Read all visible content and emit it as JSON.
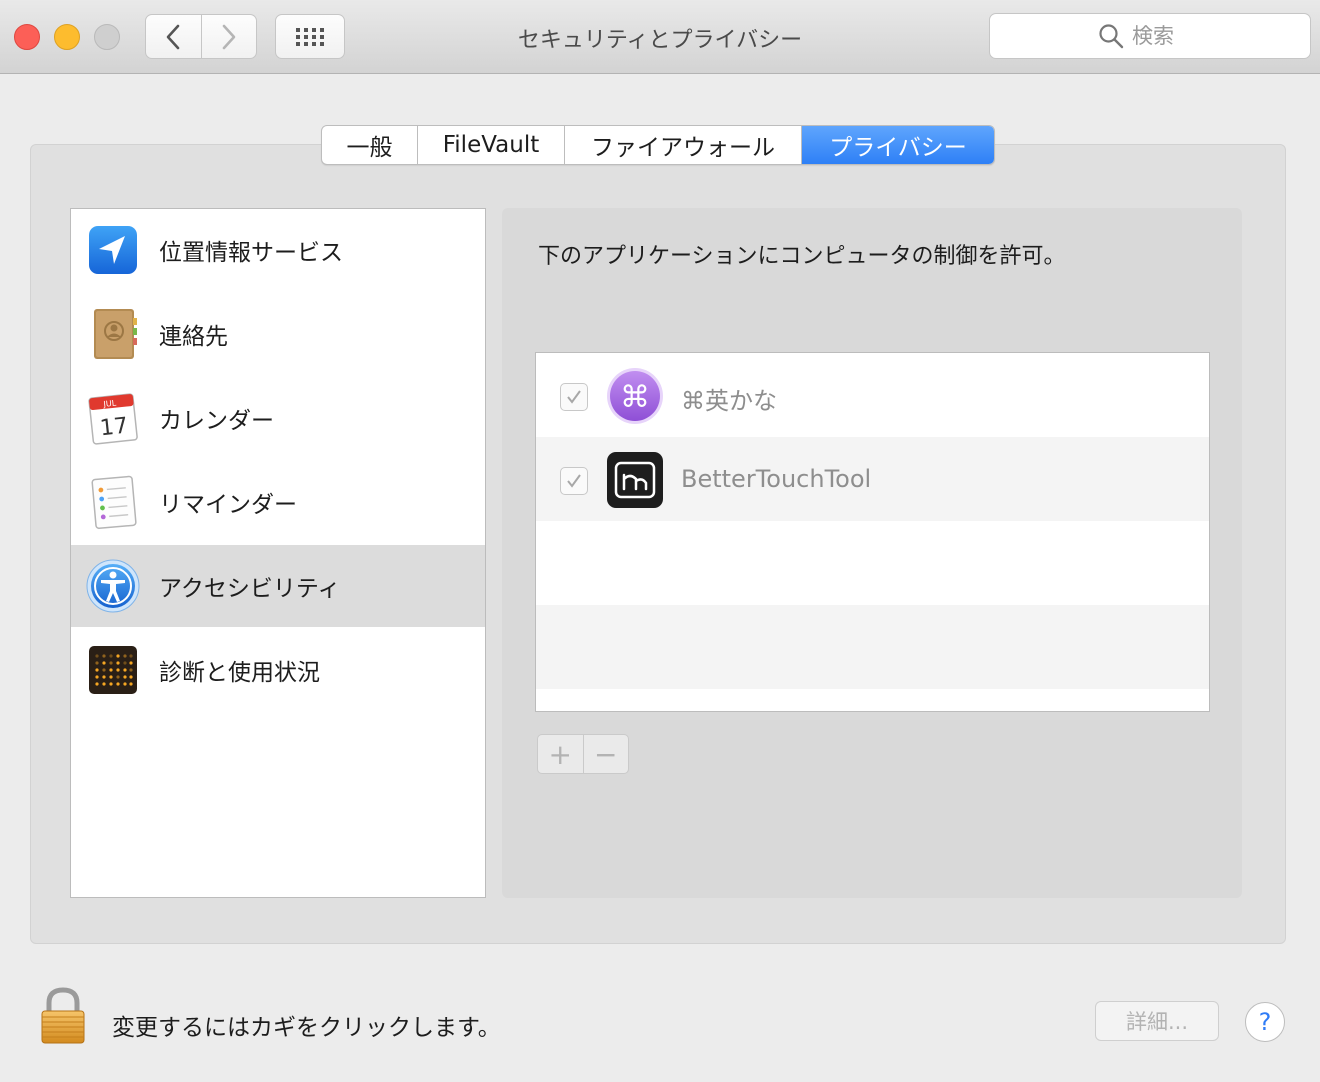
{
  "window": {
    "title": "セキュリティとプライバシー",
    "search_placeholder": "検索"
  },
  "tabs": [
    {
      "label": "一般",
      "active": false
    },
    {
      "label": "FileVault",
      "active": false
    },
    {
      "label": "ファイアウォール",
      "active": false
    },
    {
      "label": "プライバシー",
      "active": true
    }
  ],
  "sidebar": {
    "items": [
      {
        "label": "位置情報サービス",
        "icon": "location-arrow-icon",
        "selected": false
      },
      {
        "label": "連絡先",
        "icon": "contacts-book-icon",
        "selected": false
      },
      {
        "label": "カレンダー",
        "icon": "calendar-icon",
        "selected": false,
        "icon_month": "JUL",
        "icon_day": "17"
      },
      {
        "label": "リマインダー",
        "icon": "reminders-list-icon",
        "selected": false
      },
      {
        "label": "アクセシビリティ",
        "icon": "accessibility-icon",
        "selected": true
      },
      {
        "label": "診断と使用状況",
        "icon": "diagnostics-grid-icon",
        "selected": false
      }
    ]
  },
  "right_pane": {
    "heading": "下のアプリケーションにコンピュータの制御を許可。",
    "apps": [
      {
        "name": "⌘英かな",
        "checked": true,
        "icon": "eikana-command-icon"
      },
      {
        "name": "BetterTouchTool",
        "checked": true,
        "icon": "bettertouchtool-icon"
      }
    ],
    "add_label": "+",
    "remove_label": "−"
  },
  "footer": {
    "lock_text": "変更するにはカギをクリックします。",
    "details_label": "詳細...",
    "help_label": "?"
  },
  "colors": {
    "accent": "#2e80f6",
    "selected_row": "#dcdcdc"
  }
}
